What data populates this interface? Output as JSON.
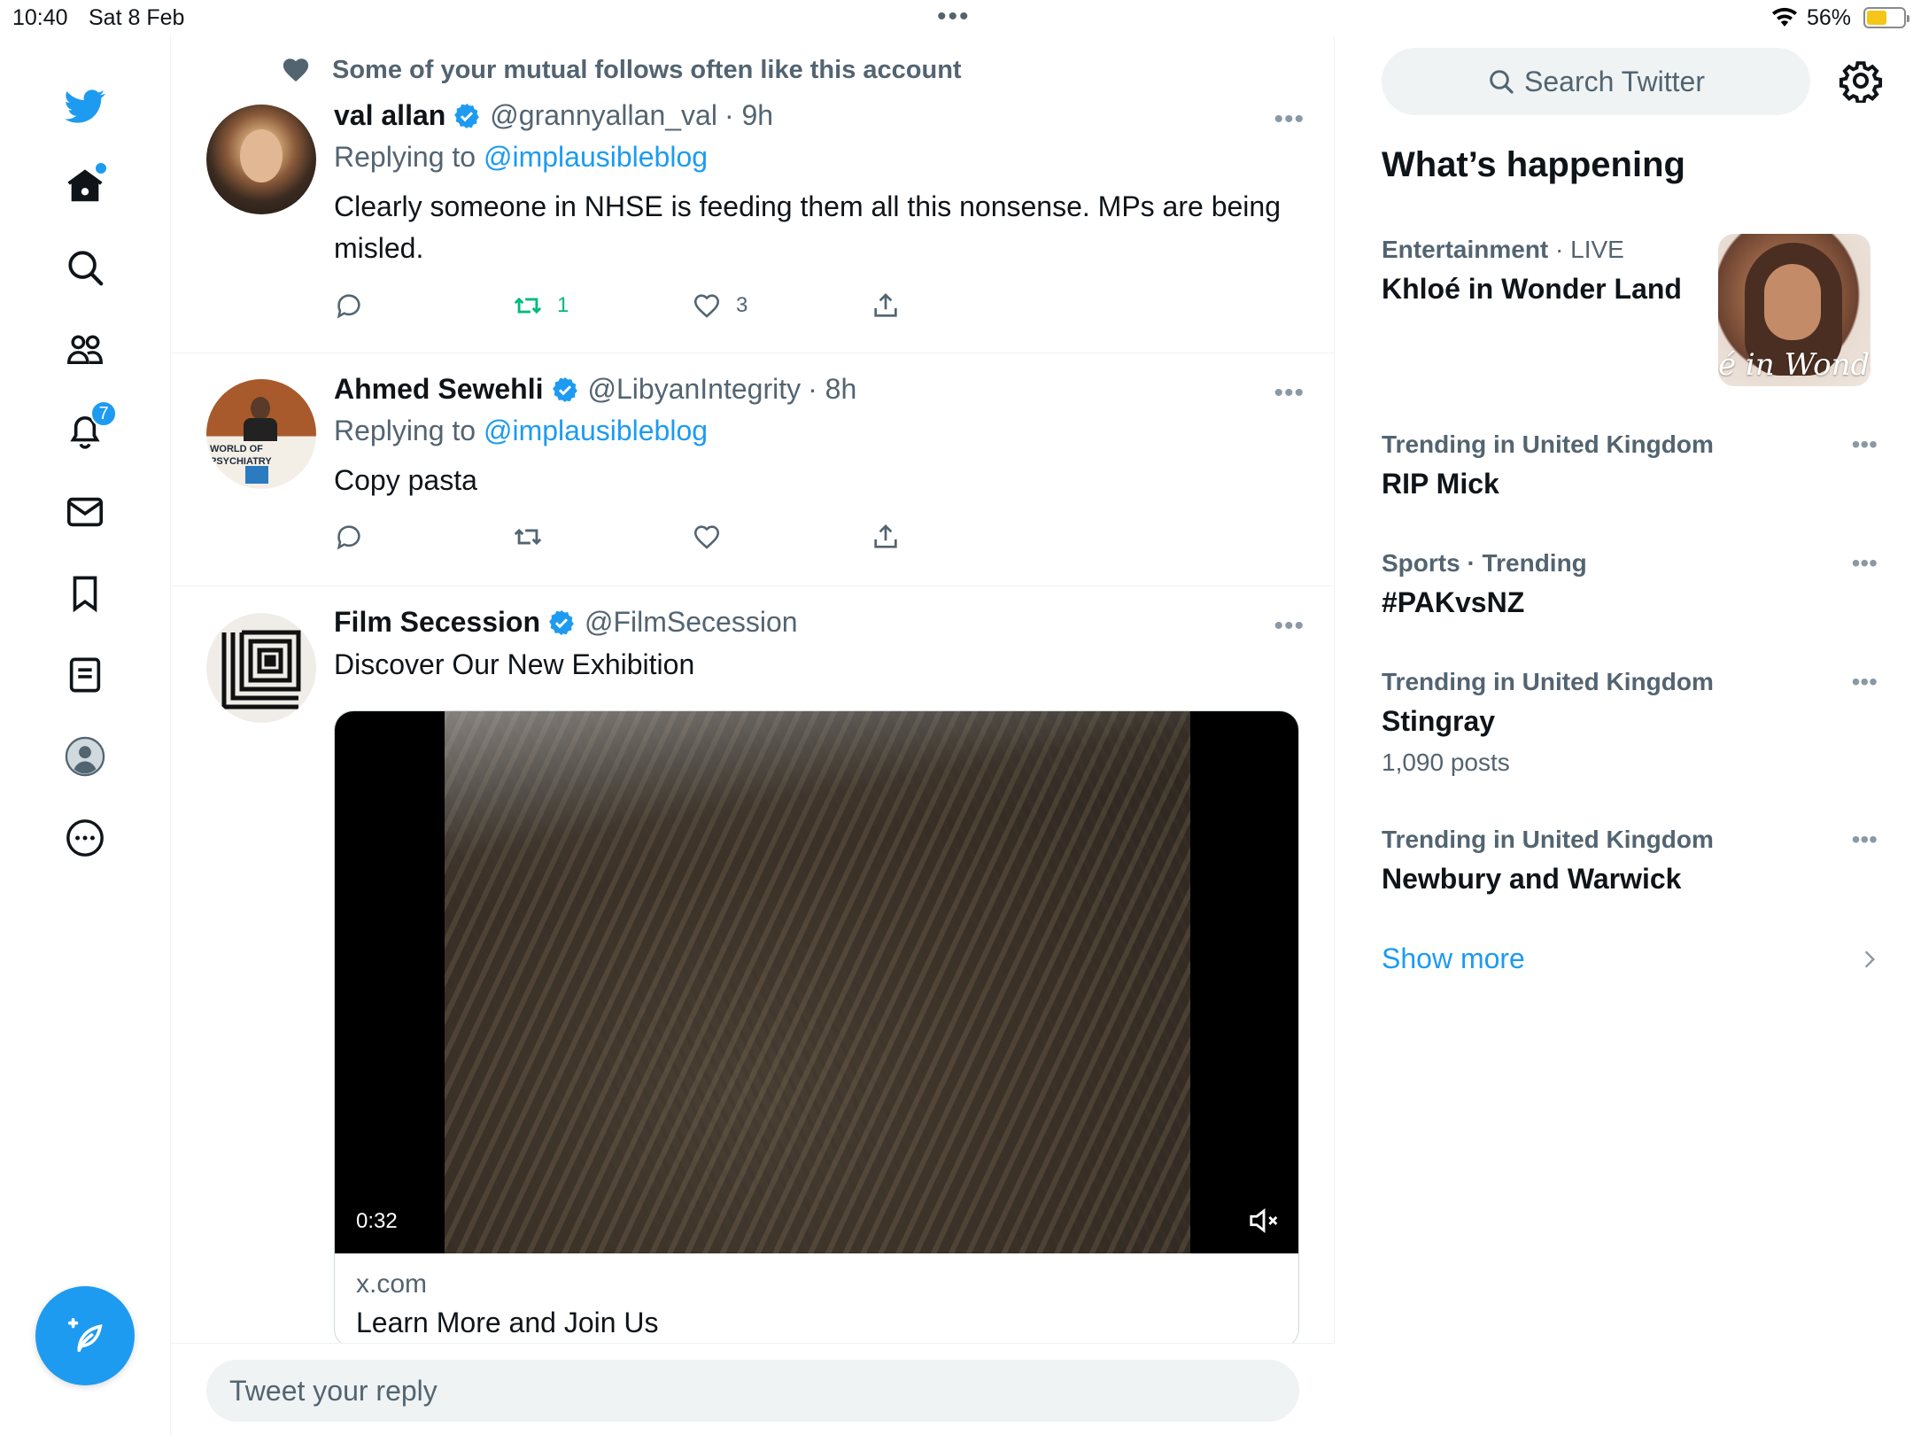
{
  "status_bar": {
    "time": "10:40",
    "date": "Sat 8 Feb",
    "battery_percent": "56%",
    "battery_level": 0.56,
    "battery_color": "#f5c518"
  },
  "colors": {
    "accent": "#1d9bf0",
    "retweet_active": "#00ba7c",
    "text_primary": "#0f1419",
    "text_secondary": "#536471"
  },
  "nav": {
    "items": [
      {
        "name": "twitter-logo",
        "icon": "bird-icon"
      },
      {
        "name": "home",
        "icon": "home-icon",
        "has_dot": true
      },
      {
        "name": "explore",
        "icon": "search-icon"
      },
      {
        "name": "communities",
        "icon": "people-icon"
      },
      {
        "name": "notifications",
        "icon": "bell-icon",
        "badge": "7"
      },
      {
        "name": "messages",
        "icon": "envelope-icon"
      },
      {
        "name": "bookmarks",
        "icon": "bookmark-icon"
      },
      {
        "name": "lists",
        "icon": "list-icon"
      },
      {
        "name": "profile",
        "icon": "profile-icon"
      },
      {
        "name": "more",
        "icon": "more-circle-icon"
      }
    ],
    "compose_icon": "compose-tweet-icon"
  },
  "feed": {
    "tweets": [
      {
        "social_context": "Some of your mutual follows often like this account",
        "name": "val allan",
        "handle": "@grannyallan_val",
        "time": "· 9h",
        "verified": true,
        "replying_to_prefix": "Replying to",
        "replying_to": "@implausibleblog",
        "text": "Clearly someone in NHSE is feeding them all this nonsense. MPs are being misled.",
        "retweets": "1",
        "likes": "3"
      },
      {
        "name": "Ahmed Sewehli",
        "handle": "@LibyanIntegrity",
        "time": "· 8h",
        "verified": true,
        "replying_to_prefix": "Replying to",
        "replying_to": "@implausibleblog",
        "avatar_caption": "WORLD OF PSYCHIATRY",
        "text": "Copy pasta"
      },
      {
        "name": "Film Secession",
        "handle": "@FilmSecession",
        "verified": true,
        "text": "Discover Our New Exhibition",
        "card": {
          "video_time": "0:32",
          "domain": "x.com",
          "title": "Learn More and Join Us"
        }
      }
    ]
  },
  "reply_bar": {
    "placeholder": "Tweet your reply"
  },
  "sidebar": {
    "search_placeholder": "Search Twitter",
    "section_title": "What’s happening",
    "trends": [
      {
        "category": "Entertainment",
        "live": "· LIVE",
        "topic": "Khloé in Wonder Land",
        "image_text": "é in Wonder L"
      },
      {
        "category": "Trending in United Kingdom",
        "topic": "RIP Mick"
      },
      {
        "category": "Sports · Trending",
        "topic": "#PAKvsNZ"
      },
      {
        "category": "Trending in United Kingdom",
        "topic": "Stingray",
        "count": "1,090 posts"
      },
      {
        "category": "Trending in United Kingdom",
        "topic": "Newbury and Warwick"
      }
    ],
    "show_more": "Show more"
  }
}
